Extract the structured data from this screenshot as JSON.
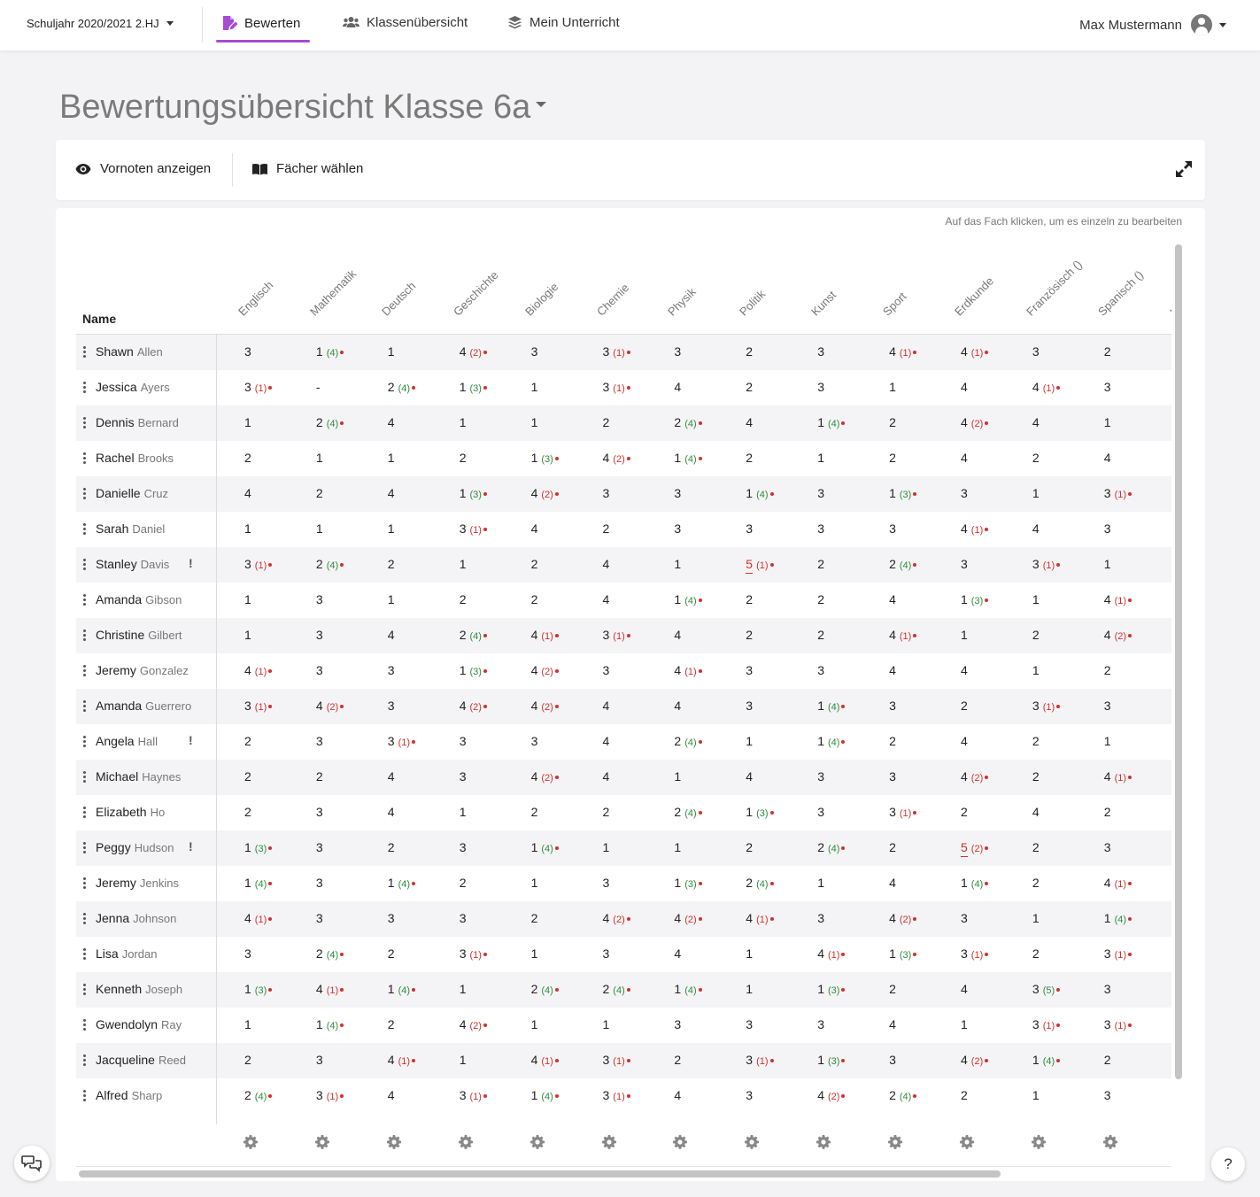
{
  "nav": {
    "year_select": "Schuljahr 2020/2021 2.HJ",
    "items": [
      {
        "label": "Bewerten",
        "icon": "edit-document-icon"
      },
      {
        "label": "Klassenübersicht",
        "icon": "users-icon"
      },
      {
        "label": "Mein Unterricht",
        "icon": "layers-icon"
      }
    ],
    "user_name": "Max Mustermann",
    "accent_color": "#a64bd3"
  },
  "page": {
    "title": "Bewertungsübersicht Klasse 6a"
  },
  "toolbar": {
    "show_pregrades": "Vornoten anzeigen",
    "choose_subjects": "Fächer wählen"
  },
  "table": {
    "hint": "Auf das Fach klicken, um es einzeln zu bearbeiten",
    "name_header": "Name",
    "subjects": [
      "Englisch",
      "Mathematik",
      "Deutsch",
      "Geschichte",
      "Biologie",
      "Chemie",
      "Physik",
      "Politik",
      "Kunst",
      "Sport",
      "Erdkunde",
      "Französisch ()",
      "Spanisch ()",
      "Info"
    ],
    "students": [
      {
        "first": "Shawn",
        "last": "Allen",
        "warn": "",
        "grades": [
          "3",
          "1 (4)",
          "1",
          "4 (2)",
          "3",
          "3 (1)",
          "3",
          "2",
          "3",
          "4 (1)",
          "4 (1)",
          "3",
          "2"
        ]
      },
      {
        "first": "Jessica",
        "last": "Ayers",
        "warn": "",
        "grades": [
          "3 (1)",
          "-",
          "2 (4)",
          "1 (3)",
          "1",
          "3 (1)",
          "4",
          "2",
          "3",
          "1",
          "4",
          "4 (1)",
          "3"
        ]
      },
      {
        "first": "Dennis",
        "last": "Bernard",
        "warn": "",
        "grades": [
          "1",
          "2 (4)",
          "4",
          "1",
          "1",
          "2",
          "2 (4)",
          "4",
          "1 (4)",
          "2",
          "4 (2)",
          "4",
          "1"
        ]
      },
      {
        "first": "Rachel",
        "last": "Brooks",
        "warn": "",
        "grades": [
          "2",
          "1",
          "1",
          "2",
          "1 (3)",
          "4 (2)",
          "1 (4)",
          "2",
          "1",
          "2",
          "4",
          "2",
          "4"
        ]
      },
      {
        "first": "Danielle",
        "last": "Cruz",
        "warn": "",
        "grades": [
          "4",
          "2",
          "4",
          "1 (3)",
          "4 (2)",
          "3",
          "3",
          "1 (4)",
          "3",
          "1 (3)",
          "3",
          "1",
          "3 (1)"
        ]
      },
      {
        "first": "Sarah",
        "last": "Daniel",
        "warn": "",
        "grades": [
          "1",
          "1",
          "1",
          "3 (1)",
          "4",
          "2",
          "3",
          "3",
          "3",
          "3",
          "4 (1)",
          "4",
          "3"
        ]
      },
      {
        "first": "Stanley",
        "last": "Davis",
        "warn": "!",
        "grades": [
          "3 (1)",
          "2 (4)",
          "2",
          "1",
          "2",
          "4",
          "1",
          "5 (1)",
          "2",
          "2 (4)",
          "3",
          "3 (1)",
          "1"
        ]
      },
      {
        "first": "Amanda",
        "last": "Gibson",
        "warn": "",
        "grades": [
          "1",
          "3",
          "1",
          "2",
          "2",
          "4",
          "1 (4)",
          "2",
          "2",
          "4",
          "1 (3)",
          "1",
          "4 (1)"
        ]
      },
      {
        "first": "Christine",
        "last": "Gilbert",
        "warn": "",
        "grades": [
          "1",
          "3",
          "4",
          "2 (4)",
          "4 (1)",
          "3 (1)",
          "4",
          "2",
          "2",
          "4 (1)",
          "1",
          "2",
          "4 (2)"
        ]
      },
      {
        "first": "Jeremy",
        "last": "Gonzalez",
        "warn": "",
        "grades": [
          "4 (1)",
          "3",
          "3",
          "1 (3)",
          "4 (2)",
          "3",
          "4 (1)",
          "3",
          "3",
          "4",
          "4",
          "1",
          "2"
        ]
      },
      {
        "first": "Amanda",
        "last": "Guerrero",
        "warn": "",
        "grades": [
          "3 (1)",
          "4 (2)",
          "3",
          "4 (2)",
          "4 (2)",
          "4",
          "4",
          "3",
          "1 (4)",
          "3",
          "2",
          "3 (1)",
          "3"
        ]
      },
      {
        "first": "Angela",
        "last": "Hall",
        "warn": "!",
        "grades": [
          "2",
          "3",
          "3 (1)",
          "3",
          "3",
          "4",
          "2 (4)",
          "1",
          "1 (4)",
          "2",
          "4",
          "2",
          "1"
        ]
      },
      {
        "first": "Michael",
        "last": "Haynes",
        "warn": "",
        "grades": [
          "2",
          "2",
          "4",
          "3",
          "4 (2)",
          "4",
          "1",
          "4",
          "3",
          "3",
          "4 (2)",
          "2",
          "4 (1)"
        ]
      },
      {
        "first": "Elizabeth",
        "last": "Ho",
        "warn": "",
        "grades": [
          "2",
          "3",
          "4",
          "1",
          "2",
          "2",
          "2 (4)",
          "1 (3)",
          "3",
          "3 (1)",
          "2",
          "4",
          "2"
        ]
      },
      {
        "first": "Peggy",
        "last": "Hudson",
        "warn": "!",
        "grades": [
          "1 (3)",
          "3",
          "2",
          "3",
          "1 (4)",
          "1",
          "1",
          "2",
          "2 (4)",
          "2",
          "5 (2)",
          "2",
          "3"
        ]
      },
      {
        "first": "Jeremy",
        "last": "Jenkins",
        "warn": "",
        "grades": [
          "1 (4)",
          "3",
          "1 (4)",
          "2",
          "1",
          "3",
          "1 (3)",
          "2 (4)",
          "1",
          "4",
          "1 (4)",
          "2",
          "4 (1)"
        ]
      },
      {
        "first": "Jenna",
        "last": "Johnson",
        "warn": "",
        "grades": [
          "4 (1)",
          "3",
          "3",
          "3",
          "2",
          "4 (2)",
          "4 (2)",
          "4 (1)",
          "3",
          "4 (2)",
          "3",
          "1",
          "1 (4)"
        ]
      },
      {
        "first": "Lisa",
        "last": "Jordan",
        "warn": "",
        "grades": [
          "3",
          "2 (4)",
          "2",
          "3 (1)",
          "1",
          "3",
          "4",
          "1",
          "4 (1)",
          "1 (3)",
          "3 (1)",
          "2",
          "3 (1)"
        ]
      },
      {
        "first": "Kenneth",
        "last": "Joseph",
        "warn": "",
        "grades": [
          "1 (3)",
          "4 (1)",
          "1 (4)",
          "1",
          "2 (4)",
          "2 (4)",
          "1 (4)",
          "1",
          "1 (3)",
          "2",
          "4",
          "3 (5)",
          "3"
        ]
      },
      {
        "first": "Gwendolyn",
        "last": "Ray",
        "warn": "",
        "grades": [
          "1",
          "1 (4)",
          "2",
          "4 (2)",
          "1",
          "1",
          "3",
          "3",
          "3",
          "4",
          "1",
          "3 (1)",
          "3 (1)"
        ]
      },
      {
        "first": "Jacqueline",
        "last": "Reed",
        "warn": "",
        "grades": [
          "2",
          "3",
          "4 (1)",
          "1",
          "4 (1)",
          "3 (1)",
          "2",
          "3 (1)",
          "1 (3)",
          "3",
          "4 (2)",
          "1 (4)",
          "2"
        ]
      },
      {
        "first": "Alfred",
        "last": "Sharp",
        "warn": "",
        "grades": [
          "2 (4)",
          "3 (1)",
          "4",
          "3 (1)",
          "1 (4)",
          "3 (1)",
          "4",
          "3",
          "4 (2)",
          "2 (4)",
          "2",
          "1",
          "3"
        ]
      }
    ]
  },
  "colors": {
    "red": "#d0312d",
    "green": "#2e8b3d"
  }
}
